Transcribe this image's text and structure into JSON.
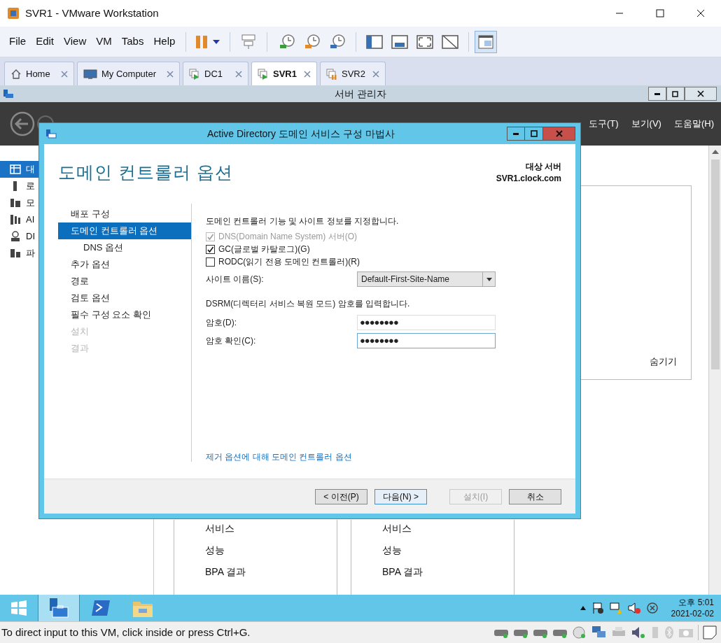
{
  "window": {
    "title": "SVR1 - VMware Workstation"
  },
  "menu": [
    "File",
    "Edit",
    "View",
    "VM",
    "Tabs",
    "Help"
  ],
  "tabs": [
    {
      "label": "Home",
      "kind": "home",
      "selected": false
    },
    {
      "label": "My Computer",
      "kind": "computer",
      "selected": false
    },
    {
      "label": "DC1",
      "kind": "running",
      "selected": false
    },
    {
      "label": "SVR1",
      "kind": "running",
      "selected": true
    },
    {
      "label": "SVR2",
      "kind": "paused",
      "selected": false
    }
  ],
  "guest": {
    "title": "서버 관리자",
    "menu": [
      "도구(T)",
      "보기(V)",
      "도움말(H)"
    ],
    "sidebar": [
      {
        "label": "대",
        "kind": "dashboard",
        "selected": true
      },
      {
        "label": "로",
        "kind": "local",
        "selected": false
      },
      {
        "label": "모",
        "kind": "all",
        "selected": false
      },
      {
        "label": "AI",
        "kind": "ad",
        "selected": false
      },
      {
        "label": "DI",
        "kind": "dns",
        "selected": false
      },
      {
        "label": "파",
        "kind": "file",
        "selected": false
      }
    ],
    "hide_link": "숨기기",
    "tiles": [
      {
        "items": [
          "서비스",
          "성능",
          "BPA 결과"
        ]
      },
      {
        "items": [
          "서비스",
          "성능",
          "BPA 결과"
        ]
      }
    ]
  },
  "dialog": {
    "title": "Active Directory 도메인 서비스 구성 마법사",
    "heading": "도메인 컨트롤러 옵션",
    "target_label": "대상 서버",
    "target_server": "SVR1.clock.com",
    "steps": [
      {
        "label": "배포 구성",
        "selected": false,
        "disabled": false
      },
      {
        "label": "도메인 컨트롤러 옵션",
        "selected": true,
        "disabled": false,
        "children": [
          {
            "label": "DNS 옵션",
            "selected": false,
            "disabled": false
          }
        ]
      },
      {
        "label": "추가 옵션",
        "selected": false,
        "disabled": false
      },
      {
        "label": "경로",
        "selected": false,
        "disabled": false
      },
      {
        "label": "검토 옵션",
        "selected": false,
        "disabled": false
      },
      {
        "label": "필수 구성 요소 확인",
        "selected": false,
        "disabled": false
      },
      {
        "label": "설치",
        "selected": false,
        "disabled": true
      },
      {
        "label": "결과",
        "selected": false,
        "disabled": true
      }
    ],
    "intro": "도메인 컨트롤러 기능 및 사이트 정보를 지정합니다.",
    "options": [
      {
        "label": "DNS(Domain Name System) 서버(O)",
        "checked": true,
        "disabled": true
      },
      {
        "label": "GC(글로벌 카탈로그)(G)",
        "checked": true,
        "disabled": false
      },
      {
        "label": "RODC(읽기 전용 도메인 컨트롤러)(R)",
        "checked": false,
        "disabled": false
      }
    ],
    "site_label": "사이트 이름(S):",
    "site_value": "Default-First-Site-Name",
    "dsrm_intro": "DSRM(디렉터리 서비스 복원 모드) 암호를 입력합니다.",
    "passwords": [
      {
        "label": "암호(D):",
        "value": "●●●●●●●●"
      },
      {
        "label": "암호 확인(C):",
        "value": "●●●●●●●●"
      }
    ],
    "link": "제거 옵션에 대해 도메인 컨트롤러 옵션",
    "buttons": [
      {
        "label": "< 이전(P)",
        "disabled": false,
        "focused": false
      },
      {
        "label": "다음(N) >",
        "disabled": false,
        "focused": true
      },
      {
        "label": "설치(I)",
        "disabled": true,
        "focused": false
      },
      {
        "label": "취소",
        "disabled": false,
        "focused": false
      }
    ]
  },
  "taskbar": {
    "apps": [
      {
        "kind": "server-manager",
        "selected": true
      },
      {
        "kind": "powershell",
        "selected": false
      },
      {
        "kind": "explorer",
        "selected": false
      }
    ],
    "time": "오후 5:01",
    "date": "2021-02-02"
  },
  "status_bar": "To direct input to this VM, click inside or press Ctrl+G."
}
